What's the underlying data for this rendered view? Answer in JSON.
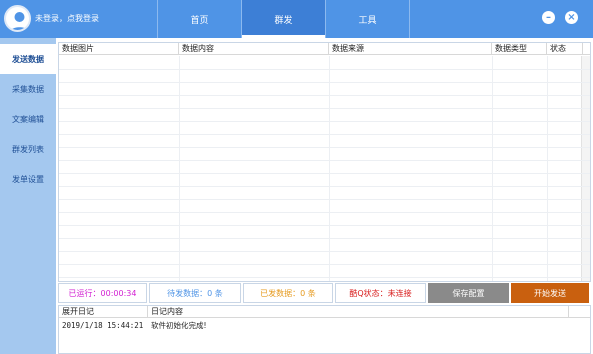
{
  "header": {
    "login_text": "未登录，点我登录",
    "tabs": [
      {
        "label": "首页",
        "active": false
      },
      {
        "label": "群发",
        "active": true
      },
      {
        "label": "工具",
        "active": false
      }
    ],
    "accent_color": "#4f94e6"
  },
  "sidebar": {
    "items": [
      {
        "label": "发送数据",
        "active": true
      },
      {
        "label": "采集数据",
        "active": false
      },
      {
        "label": "文案编辑",
        "active": false
      },
      {
        "label": "群发列表",
        "active": false
      },
      {
        "label": "发单设置",
        "active": false
      }
    ]
  },
  "table": {
    "columns": [
      "数据图片",
      "数据内容",
      "数据来源",
      "数据类型",
      "状态"
    ],
    "rows": []
  },
  "status": {
    "running": "已运行：00:00:34",
    "pending": "待发数据：0 条",
    "sent": "已发数据：0 条",
    "qq_status": "酷Q状态：未连接",
    "save_button": "保存配置",
    "start_button": "开始发送",
    "colors": {
      "running": "#d21fd2",
      "pending": "#4f94e6",
      "sent": "#e69a1e",
      "qq_status": "#d81b1b",
      "save_bg": "#8a8a8a",
      "start_bg": "#c9600f"
    }
  },
  "log": {
    "columns": [
      "展开日记",
      "日记内容"
    ],
    "rows": [
      {
        "time": "2019/1/18 15:44:21",
        "content": "软件初始化完成!"
      }
    ]
  }
}
